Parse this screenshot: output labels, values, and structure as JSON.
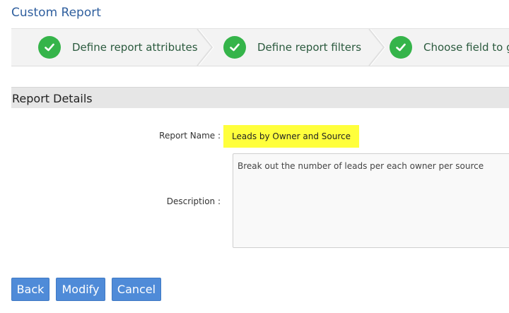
{
  "page": {
    "title": "Custom Report"
  },
  "wizard": {
    "steps": [
      {
        "label": "Define report attributes",
        "status": "complete",
        "icon": "check-icon"
      },
      {
        "label": "Define report filters",
        "status": "complete",
        "icon": "check-icon"
      },
      {
        "label": "Choose field to g",
        "status": "complete",
        "icon": "check-icon"
      }
    ]
  },
  "section": {
    "title": "Report Details"
  },
  "form": {
    "report_name_label": "Report Name :",
    "report_name_value": "Leads by Owner and Source",
    "description_label": "Description :",
    "description_value": "Break out the number of leads  per each owner per source"
  },
  "buttons": {
    "back": "Back",
    "modify": "Modify",
    "cancel": "Cancel"
  },
  "colors": {
    "accent": "#4f8bd8",
    "title": "#2f5f9e",
    "check": "#35b44a",
    "highlight": "#ffff3c"
  }
}
